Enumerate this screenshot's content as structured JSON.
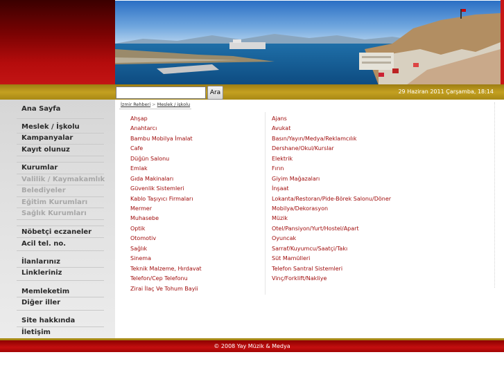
{
  "header": {
    "photo_alt": "harbor"
  },
  "search": {
    "placeholder": "",
    "button_label": "Ara"
  },
  "datetime": "29 Haziran 2011 Çarşamba, 18:14",
  "sidebar": {
    "items": [
      {
        "label": "Ana Sayfa"
      },
      {
        "label": "Meslek / İşkolu"
      },
      {
        "label": "Kampanyalar"
      },
      {
        "label": "Kayıt olunuz"
      },
      {
        "label": "Kurumlar"
      },
      {
        "label": "Valilik / Kaymakamlık"
      },
      {
        "label": "Belediyeler"
      },
      {
        "label": "Eğitim Kurumları"
      },
      {
        "label": "Sağlık Kurumları"
      },
      {
        "label": "Nöbetçi eczaneler"
      },
      {
        "label": "Acil tel. no."
      },
      {
        "label": "İlanlarınız"
      },
      {
        "label": "Linkleriniz"
      },
      {
        "label": "Memleketim"
      },
      {
        "label": "Diğer iller"
      },
      {
        "label": "Site hakkında"
      },
      {
        "label": "İletişim"
      }
    ]
  },
  "breadcrumb": {
    "root": "İzmir Rehberi",
    "separator": ">",
    "current": "Meslek / işkolu"
  },
  "categories": {
    "left": [
      "Ahşap",
      "Anahtarcı",
      "Bambu Mobilya İmalat",
      "Cafe",
      "Düğün Salonu",
      "Emlak",
      "Gıda Makinaları",
      "Güvenlik Sistemleri",
      "Kablo Taşıyıcı Firmaları",
      "Mermer",
      "Muhasebe",
      "Optik",
      "Otomotiv",
      "Sağlık",
      "Sinema",
      "Teknik Malzeme, Hırdavat",
      "Telefon/Cep Telefonu",
      "Zirai İlaç Ve Tohum Bayii"
    ],
    "right": [
      "Ajans",
      "Avukat",
      "Basın/Yayın/Medya/Reklamcılık",
      "Dershane/Okul/Kurslar",
      "Elektrik",
      "Fırın",
      "Giyim Mağazaları",
      "İnşaat",
      "Lokanta/Restoran/Pide-Börek Salonu/Döner",
      "Mobilya/Dekorasyon",
      "Müzik",
      "Otel/Pansiyon/Yurt/Hostel/Apart",
      "Oyuncak",
      "Sarraf/Kuyumcu/Saatçi/Takı",
      "Süt Mamülleri",
      "Telefon Santral Sistemleri",
      "Vinç/Forklift/Nakliye"
    ]
  },
  "footer": {
    "text": "© 2008 Yay Müzik & Medya"
  },
  "colors": {
    "link": "#a00c0c",
    "brand_red": "#c21414",
    "gold": "#c4a021"
  }
}
